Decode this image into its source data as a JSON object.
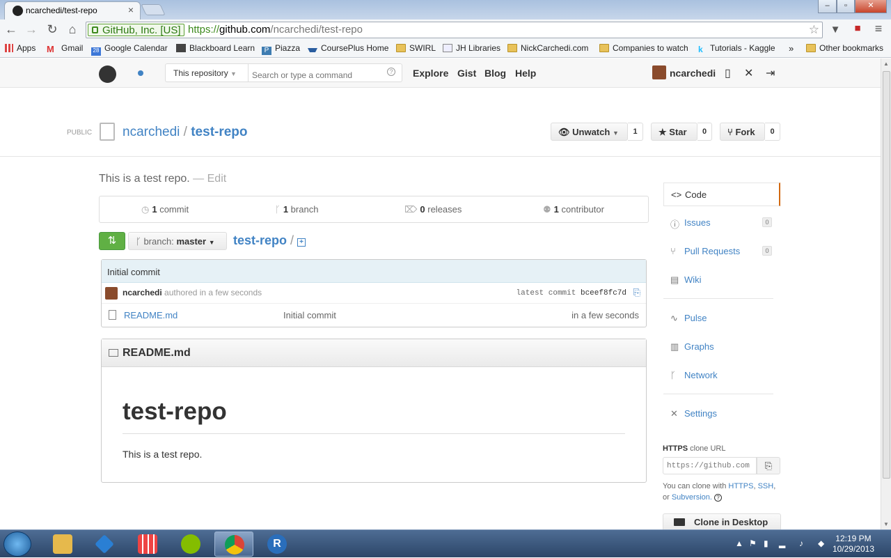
{
  "browser": {
    "tab_title": "ncarchedi/test-repo",
    "tab_close": "×",
    "secure_label": "GitHub, Inc. [US]",
    "url_scheme": "https://",
    "url_host": "github.com",
    "url_path": "/ncarchedi/test-repo",
    "window_buttons": [
      "–",
      "▫",
      "✕"
    ],
    "bookmarks": [
      {
        "label": "Apps",
        "icon": "apps-grid-icon"
      },
      {
        "label": "Gmail",
        "icon": "gmail-icon"
      },
      {
        "label": "Google Calendar",
        "icon": "calendar-icon"
      },
      {
        "label": "Blackboard Learn",
        "icon": "blackboard-icon"
      },
      {
        "label": "Piazza",
        "icon": "piazza-icon"
      },
      {
        "label": "CoursePlus Home",
        "icon": "courseplus-icon"
      },
      {
        "label": "SWIRL",
        "icon": "folder-icon"
      },
      {
        "label": "JH Libraries",
        "icon": "jh-icon"
      },
      {
        "label": "NickCarchedi.com",
        "icon": "folder-icon"
      },
      {
        "label": "Companies to watch",
        "icon": "folder-icon"
      },
      {
        "label": "Tutorials - Kaggle",
        "icon": "kaggle-icon"
      }
    ],
    "bookmarks_overflow": "»",
    "other_bookmarks": "Other bookmarks"
  },
  "gh_header": {
    "scope_label": "This repository",
    "search_placeholder": "Search or type a command",
    "nav": [
      "Explore",
      "Gist",
      "Blog",
      "Help"
    ],
    "username": "ncarchedi"
  },
  "repo": {
    "visibility": "PUBLIC",
    "owner": "ncarchedi",
    "separator": "/",
    "name": "test-repo",
    "watch_label": "Unwatch",
    "watch_count": "1",
    "star_label": "Star",
    "star_count": "0",
    "fork_label": "Fork",
    "fork_count": "0",
    "description": "This is a test repo.",
    "edit_label": "— Edit",
    "summary": [
      {
        "count": "1",
        "label": "commit"
      },
      {
        "count": "1",
        "label": "branch"
      },
      {
        "count": "0",
        "label": "releases"
      },
      {
        "count": "1",
        "label": "contributor"
      }
    ],
    "branch_prefix": "branch:",
    "branch_name": "master",
    "breadcrumb_repo": "test-repo",
    "breadcrumb_sep": "/",
    "commit_message": "Initial commit",
    "commit_author": "ncarchedi",
    "commit_time": "authored in a few seconds",
    "latest_commit_label": "latest commit",
    "commit_sha": "bceef8fc7d",
    "files": [
      {
        "name": "README.md",
        "message": "Initial commit",
        "age": "in a few seconds"
      }
    ],
    "readme_filename": "README.md",
    "readme_title": "test-repo",
    "readme_body": "This is a test repo."
  },
  "sidebar": {
    "items": [
      {
        "label": "Code",
        "icon": "code-icon"
      },
      {
        "label": "Issues",
        "icon": "issues-icon",
        "count": "0"
      },
      {
        "label": "Pull Requests",
        "icon": "pull-request-icon",
        "count": "0"
      },
      {
        "label": "Wiki",
        "icon": "wiki-icon"
      },
      {
        "label": "Pulse",
        "icon": "pulse-icon"
      },
      {
        "label": "Graphs",
        "icon": "graphs-icon"
      },
      {
        "label": "Network",
        "icon": "network-icon"
      },
      {
        "label": "Settings",
        "icon": "settings-icon"
      }
    ],
    "clone_protocol": "HTTPS",
    "clone_label": "clone URL",
    "clone_url": "https://github.com",
    "clone_help_prefix": "You can clone with",
    "clone_https": "HTTPS",
    "clone_ssh": "SSH",
    "clone_or": "or",
    "clone_svn": "Subversion.",
    "clone_desktop": "Clone in Desktop"
  },
  "taskbar": {
    "time": "12:19 PM",
    "date": "10/29/2013"
  },
  "colors": {
    "link": "#4183c4",
    "compare_green": "#60b044",
    "active_tab_accent": "#d26911"
  }
}
